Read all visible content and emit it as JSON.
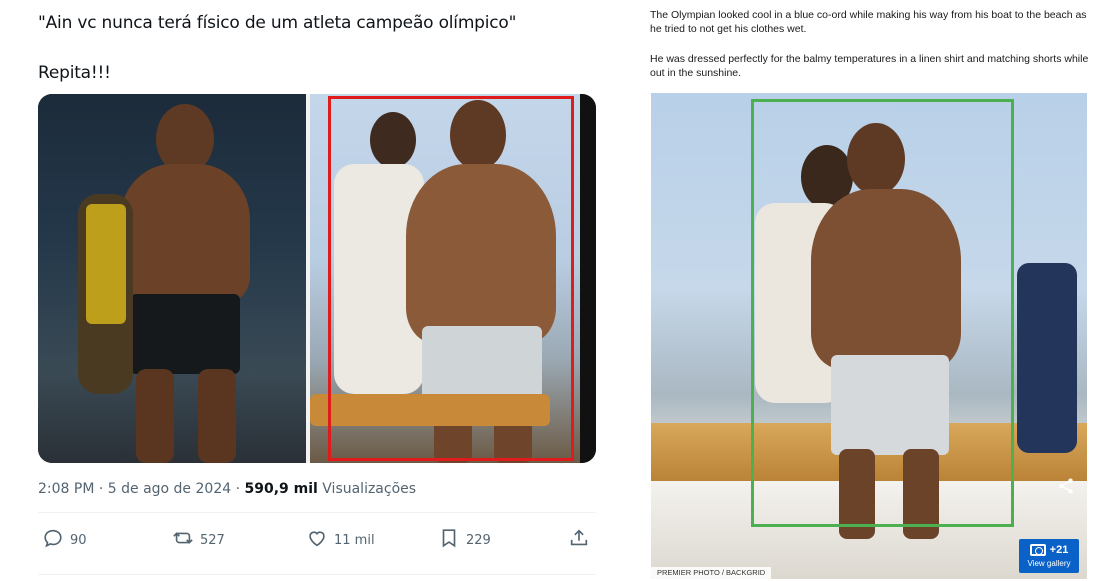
{
  "tweet": {
    "text_line1": "\"Ain vc nunca terá físico de um atleta campeão olímpico\"",
    "text_line2": "Repita!!!",
    "timestamp_prefix": "2:08 PM · 5 de ago de 2024 · ",
    "views_count": "590,9 mil",
    "views_label": " Visualizações",
    "actions": {
      "replies": "90",
      "reposts": "527",
      "likes": "11 mil",
      "bookmarks": "229"
    },
    "colors": {
      "highlight_box": "#e01b1b",
      "text_secondary": "#536471"
    }
  },
  "article": {
    "paragraph1": "The Olympian looked cool in a blue co-ord while making his way from his boat to the beach as he tried to not get his clothes wet.",
    "paragraph2": "He was dressed perfectly for the balmy temperatures in a linen shirt and matching shorts while out in the sunshine.",
    "gallery_count": "+21",
    "gallery_label": "View gallery",
    "photo_credit": "PREMIER PHOTO / BACKGRID",
    "colors": {
      "highlight_box": "#4caf50",
      "gallery_badge": "#0a62c8"
    }
  },
  "icons": [
    "reply-icon",
    "repost-icon",
    "like-icon",
    "bookmark-icon",
    "share-icon",
    "camera-icon"
  ]
}
